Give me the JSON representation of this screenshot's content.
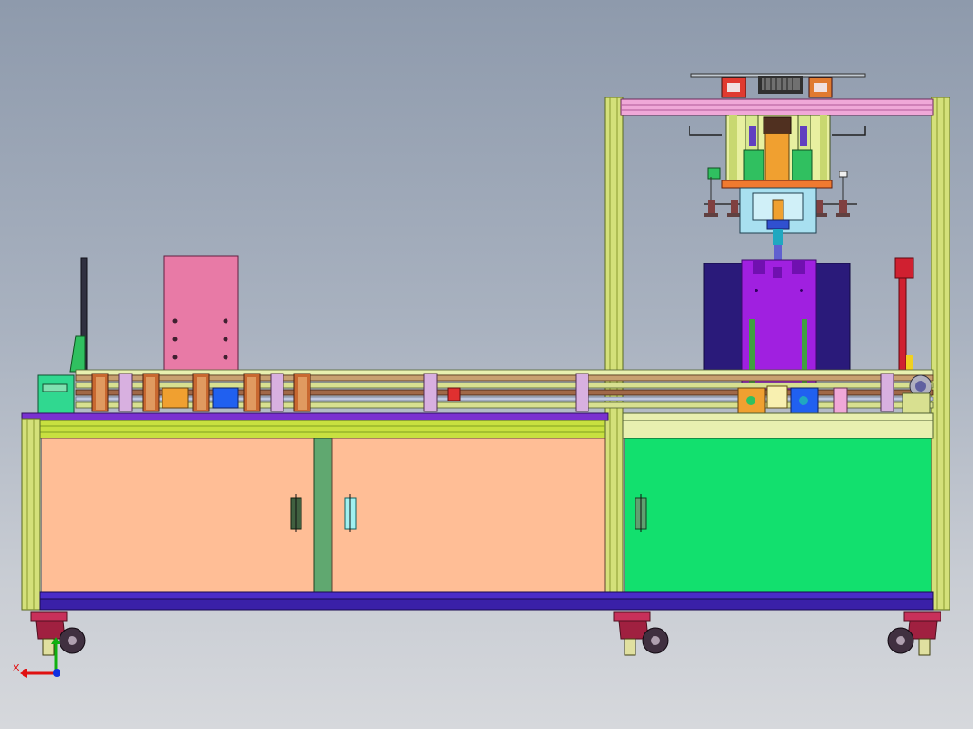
{
  "viewport": {
    "axis_label": "X",
    "colors": {
      "background_top": "#8e9aac",
      "background_bottom": "#d6d8dc",
      "frame_profile": "#d4e07a",
      "cabinet_door_left": "#ffbe96",
      "cabinet_door_right": "#12e06e",
      "base_rail": "#4a2cc8",
      "pink_panel": "#e87aa6",
      "press_body": "#a020e0",
      "press_backplate": "#2a1a7a",
      "caster_body": "#c8305a",
      "axis_x": "#e01010",
      "axis_y": "#10b010",
      "axis_z": "#1030e0"
    }
  }
}
